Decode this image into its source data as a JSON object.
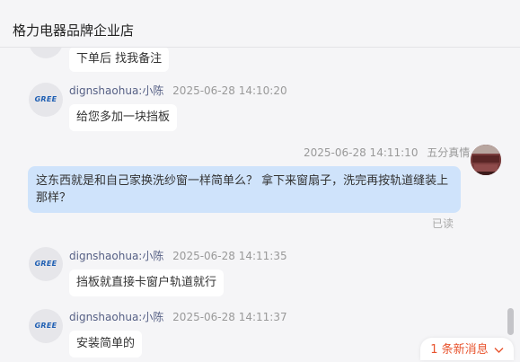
{
  "header": {
    "title": "格力电器品牌企业店"
  },
  "messages": [
    {
      "text": "下单后 找我备注"
    },
    {
      "nickname": "dignshaohua:小陈",
      "time": "2025-06-28 14:10:20",
      "text": "给您多加一块挡板"
    },
    {
      "time": "2025-06-28 14:11:10",
      "nickname": "五分真情",
      "text": "这东西就是和自己家换洗纱窗一样简单么？ 拿下来窗扇子，洗完再按轨道缝装上那样？",
      "status": "已读"
    },
    {
      "nickname": "dignshaohua:小陈",
      "time": "2025-06-28 14:11:35",
      "text": "挡板就直接卡窗户轨道就行"
    },
    {
      "nickname": "dignshaohua:小陈",
      "time": "2025-06-28 14:11:37",
      "text": "安装简单的"
    }
  ],
  "avatar": {
    "logo_text": "GREE",
    "logo_color": "#1f5fb3"
  },
  "new_message": {
    "label": "1 条新消息",
    "icon": "chevron-down-icon"
  },
  "colors": {
    "accent": "#e8542e",
    "bubble_me": "#cfe3fb",
    "nickname": "#566085"
  }
}
